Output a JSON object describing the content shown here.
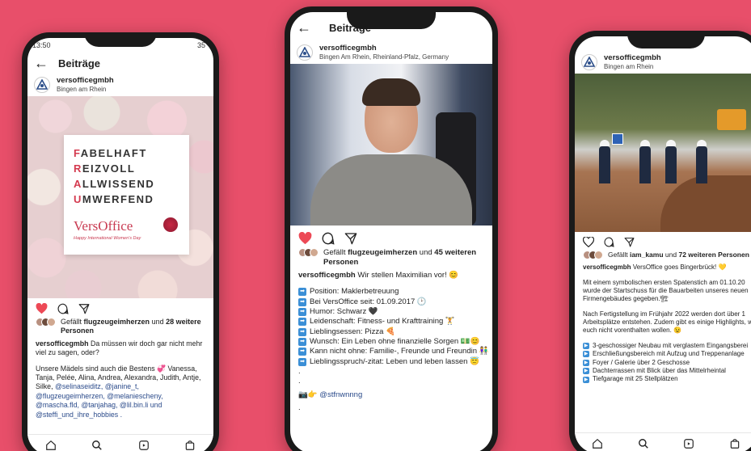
{
  "phone1": {
    "status": {
      "time": "13:50",
      "right": "35"
    },
    "header": {
      "title": "Beiträge"
    },
    "account": {
      "name": "versofficegmbh",
      "location": "Bingen am Rhein"
    },
    "image": {
      "words": [
        {
          "first": "F",
          "rest": "ABELHAFT"
        },
        {
          "first": "R",
          "rest": "EIZVOLL"
        },
        {
          "first": "A",
          "rest": "LLWISSEND"
        },
        {
          "first": "U",
          "rest": "MWERFEND"
        }
      ],
      "brand": "VersOffice",
      "tagline": "Happy International Women's Day"
    },
    "likes": {
      "prefix": "Gefällt",
      "user": "flugzeugeimherzen",
      "mid": "und",
      "count": "28 weitere",
      "suffix": "Personen"
    },
    "caption": {
      "user": "versofficegmbh",
      "text": "Da müssen wir doch gar nicht mehr viel zu sagen, oder?",
      "p2": "Unsere Mädels sind auch die Bestens 💞 Vanessa, Tanja, Pelée, Alina, Andrea, Alexandra, Judith, Antje, Silke,",
      "mentions": "@selinaseiditz, @janine_t, @flugzeugeimherzen, @melaniescheny, @mascha.fld, @tanjahag, @lil.bin.li und @steffi_und_ihre_hobbies ."
    }
  },
  "phone2": {
    "header": {
      "title": "Beiträge"
    },
    "account": {
      "name": "versofficegmbh",
      "location": "Bingen Am Rhein, Rheinland-Pfalz, Germany"
    },
    "likes": {
      "prefix": "Gefällt",
      "user": "flugzeugeimherzen",
      "mid": "und",
      "count": "45 weiteren",
      "suffix": "Personen"
    },
    "caption": {
      "user": "versofficegmbh",
      "text": "Wir stellen Maximilian vor! 😊",
      "lines": [
        "Position: Maklerbetreuung",
        "Bei VersOffice seit:  01.09.2017 🕑",
        "Humor: Schwarz 🖤",
        "Leidenschaft: Fitness- und Krafttraining 🏋",
        "Lieblingsessen: Pizza 🍕",
        "Wunsch: Ein Leben ohne finanzielle Sorgen 💵😊",
        "Kann nicht ohne: Familie-, Freunde und Freundin 👫",
        "Lieblingsspruch/-zitat: Leben und leben lassen 😇"
      ],
      "dot1": ".",
      "dot2": ".",
      "credit": "📷👉 @stfnwnnng",
      "dot3": "."
    }
  },
  "phone3": {
    "account": {
      "name": "versofficegmbh",
      "location": "Bingen am Rhein"
    },
    "likes": {
      "prefix": "Gefällt",
      "user": "iam_kamu",
      "mid": "und",
      "count": "72 weiteren Personen"
    },
    "caption": {
      "user": "versofficegmbh",
      "text": "VersOffice goes Bingerbrück! 💛",
      "p1": "Mit einem symbolischen ersten Spatenstich am 01.10.20 wurde der Startschuss für die Bauarbeiten unseres neuen Firmengebäudes gegeben.🏗",
      "p2": "Nach Fertigstellung im Frühjahr 2022 werden dort über 1 Arbeitsplätze entstehen. Zudem gibt es einige Highlights, wir euch nicht vorenthalten wollen. 😉",
      "bullets": [
        "3-geschossiger Neubau mit verglastem Eingangsberei",
        "Erschließungsbereich mit Aufzug und Treppenanlage",
        "Foyer / Galerie über 2 Geschosse",
        "Dachterrassen mit Blick über das Mittelrheintal",
        "Tiefgarage mit 25 Stellplätzen"
      ]
    }
  }
}
